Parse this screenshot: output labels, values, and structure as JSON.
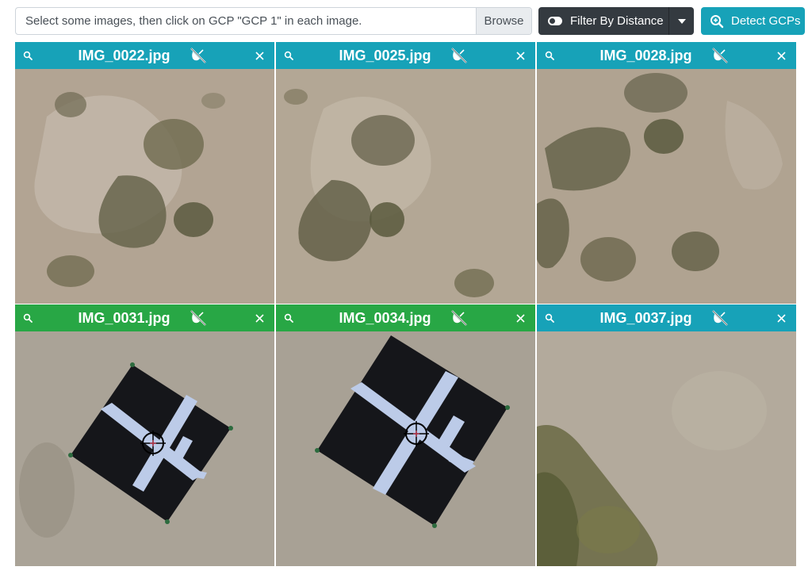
{
  "toolbar": {
    "file_placeholder": "Select some images, then click on GCP \"GCP 1\" in each image.",
    "browse_label": "Browse",
    "filter_label": "Filter By Distance",
    "detect_label": "Detect GCPs"
  },
  "colors": {
    "teal": "#17a2b8",
    "green": "#28a745",
    "dark": "#343a40",
    "sand": "#b7aa99",
    "shrub": "#6e6a4f"
  },
  "icons": {
    "filter_toggle": "toggle-icon",
    "filter_caret": "caret-down-icon",
    "detect": "search-plus-icon",
    "card_zoom": "search-icon",
    "card_gps": "no-gps-satellite-icon",
    "card_close": "close-icon"
  },
  "images": [
    {
      "name": "IMG_0022.jpg",
      "status": "unmarked",
      "content": "sand dunes with shrubs"
    },
    {
      "name": "IMG_0025.jpg",
      "status": "unmarked",
      "content": "sand dunes with shrubs"
    },
    {
      "name": "IMG_0028.jpg",
      "status": "unmarked",
      "content": "sand dunes with shrubs"
    },
    {
      "name": "IMG_0031.jpg",
      "status": "marked",
      "content": "ground control target with crosshair"
    },
    {
      "name": "IMG_0034.jpg",
      "status": "marked",
      "content": "ground control target with crosshair"
    },
    {
      "name": "IMG_0037.jpg",
      "status": "unmarked",
      "content": "sand with vegetation"
    }
  ]
}
